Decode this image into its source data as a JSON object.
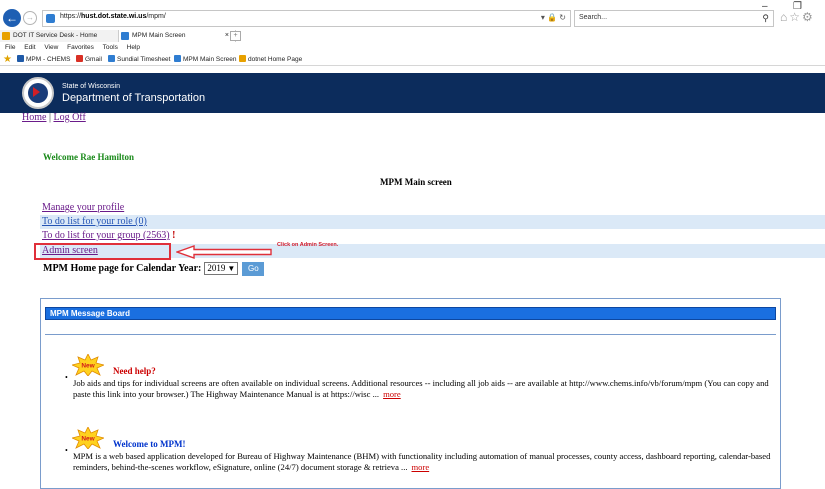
{
  "window": {
    "minimize": "–",
    "maximize": "❐"
  },
  "browser": {
    "url_prefix": "https://",
    "url_host": "hust.dot.state.wi.us",
    "url_path": "/mpm/",
    "search_placeholder": "Search...",
    "tabs": [
      {
        "label": "DOT IT Service Desk - Home"
      },
      {
        "label": "MPM Main Screen",
        "close": "×"
      }
    ],
    "menu": [
      "File",
      "Edit",
      "View",
      "Favorites",
      "Tools",
      "Help"
    ],
    "favorites": [
      {
        "label": "MPM - CHEMS",
        "color": "#1f5aa8"
      },
      {
        "label": "Gmail",
        "color": "#d93025"
      },
      {
        "label": "Sundial Timesheet",
        "color": "#2f7dd1"
      },
      {
        "label": "MPM Main Screen",
        "color": "#2f7dd1"
      },
      {
        "label": "dotnet Home Page",
        "color": "#e8a100"
      }
    ]
  },
  "header": {
    "state": "State of Wisconsin",
    "department": "Department of Transportation"
  },
  "nav": {
    "home": "Home",
    "separator": " | ",
    "logoff": "Log Off"
  },
  "welcome": "Welcome Rae Hamilton",
  "page_title": "MPM Main screen",
  "menu_links": {
    "profile": "Manage your profile",
    "role": "To do list for your role (0)",
    "group": "To do list for your group (2563)",
    "group_flag": " !",
    "admin": "Admin screen"
  },
  "annotation": "Click on Admin Screen.",
  "calendar": {
    "label": "MPM Home page for Calendar Year:",
    "selected_year": "2019",
    "go_label": "Go"
  },
  "board": {
    "title": "MPM Message Board",
    "badge": "New",
    "messages": [
      {
        "title": "Need help?",
        "body": "Job aids and tips for individual screens are often available on individual screens. Additional resources -- including all job aids -- are available at http://www.chems.info/vb/forum/mpm (You can copy and paste this link into your browser.) The Highway Maintenance Manual is at https://wisc ...",
        "more": "more"
      },
      {
        "title": "Welcome to MPM!",
        "body": "MPM is a web based application developed for Bureau of Highway Maintenance (BHM) with functionality including automation of manual processes, county access, dashboard reporting, calendar-based reminders, behind-the-scenes workflow, eSignature, online (24/7) document storage & retrieva ...",
        "more": "more"
      }
    ]
  },
  "colors": {
    "header_bg": "#0c2c5c",
    "link_visited": "#6a1b8a",
    "link": "#2454b5",
    "welcome": "#1a8a1a",
    "highlight_row": "#dbe9f7",
    "annotation": "#e0303a",
    "board_header": "#1a6fe0",
    "go_button": "#5b9bd5"
  }
}
